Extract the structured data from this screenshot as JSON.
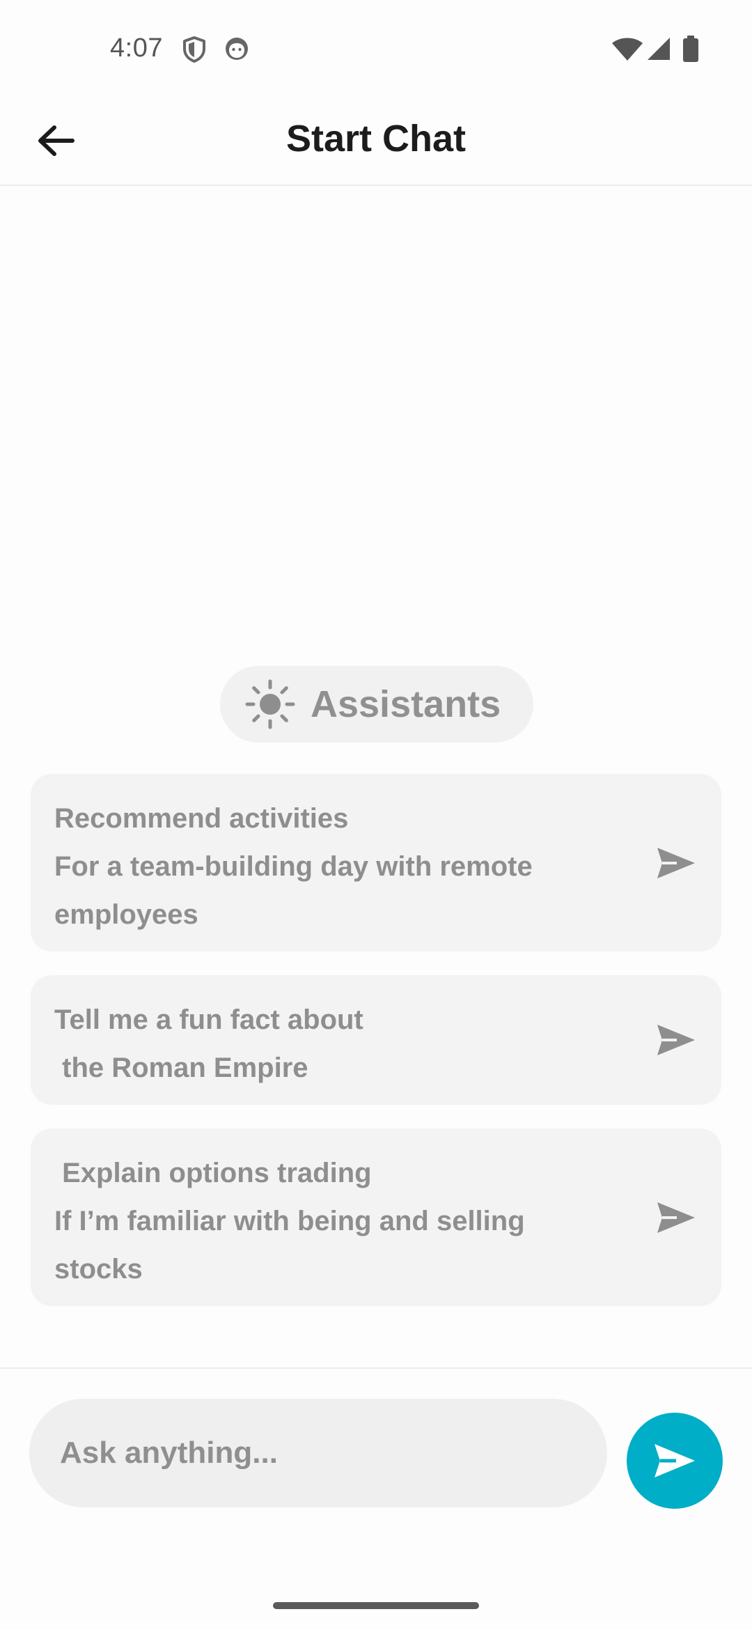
{
  "status_bar": {
    "time": "4:07",
    "left_icons": [
      "shield-icon",
      "face-icon"
    ],
    "right_icons": [
      "wifi-icon",
      "cellular-signal-icon",
      "battery-icon"
    ]
  },
  "header": {
    "back_icon": "arrow-left-icon",
    "title": "Start Chat"
  },
  "assistants": {
    "icon": "sun-icon",
    "label": "Assistants"
  },
  "suggestions": [
    {
      "text": "Recommend activities\nFor a team-building day with remote employees",
      "icon": "send-icon"
    },
    {
      "text": "Tell me a fun fact about\n the Roman Empire",
      "icon": "send-icon"
    },
    {
      "text": " Explain options trading\nIf I’m familiar with being and selling stocks",
      "icon": "send-icon"
    }
  ],
  "composer": {
    "placeholder": "Ask anything...",
    "value": "",
    "send_icon": "send-icon"
  },
  "colors": {
    "accent": "#00aec7",
    "card_background": "#f3f3f3",
    "muted_text": "#8e8e8e",
    "title_text": "#1c1c1c"
  }
}
